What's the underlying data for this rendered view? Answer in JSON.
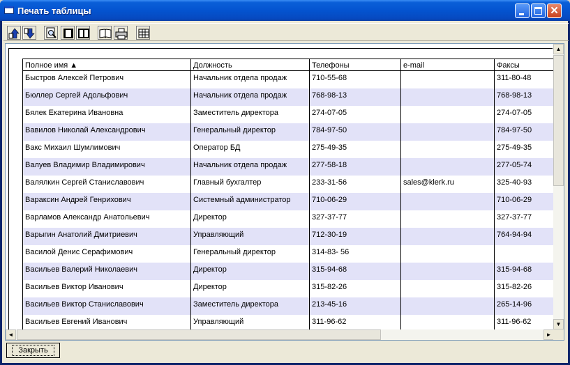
{
  "window": {
    "title": "Печать таблицы",
    "close_glyph": "✕"
  },
  "toolbar": {
    "tools": [
      "up-arrow-icon",
      "down-arrow-icon",
      "zoom-icon",
      "one-page-icon",
      "two-page-icon",
      "book-icon",
      "printer-icon",
      "grid-icon"
    ]
  },
  "table": {
    "headers": [
      "Полное имя ▲",
      "Должность",
      "Телефоны",
      "e-mail",
      "Факсы"
    ],
    "rows": [
      [
        "Быстров Алексей Петрович",
        "Начальник отдела продаж",
        "710-55-68",
        "",
        "311-80-48"
      ],
      [
        "Бюллер Сергей Адольфович",
        "Начальник отдела продаж",
        "768-98-13",
        "",
        "768-98-13"
      ],
      [
        "Бялек Екатерина Ивановна",
        "Заместитель директора",
        "274-07-05",
        "",
        "274-07-05"
      ],
      [
        "Вавилов Николай Александрович",
        "Генеральный директор",
        "784-97-50",
        "",
        "784-97-50"
      ],
      [
        "Вакс Михаил Шумлимович",
        "Оператор БД",
        "275-49-35",
        "",
        "275-49-35"
      ],
      [
        "Валуев Владимир Владимирович",
        "Начальник отдела продаж",
        "277-58-18",
        "",
        "277-05-74"
      ],
      [
        "Валялкин Сергей Станиславович",
        "Главный бухгалтер",
        "233-31-56",
        "sales@klerk.ru",
        "325-40-93"
      ],
      [
        "Вараксин Андрей Генрихович",
        "Системный администратор",
        "710-06-29",
        "",
        "710-06-29"
      ],
      [
        "Варламов Александр Анатольевич",
        "Директор",
        "327-37-77",
        "",
        "327-37-77"
      ],
      [
        "Варыгин Анатолий Дмитриевич",
        "Управляющий",
        "712-30-19",
        "",
        "764-94-94"
      ],
      [
        "Василой Денис Серафимович",
        "Генеральный директор",
        "314-83- 56",
        "",
        ""
      ],
      [
        "Васильев Валерий Николаевич",
        "Директор",
        "315-94-68",
        "",
        "315-94-68"
      ],
      [
        "Васильев Виктор Иванович",
        "Директор",
        "315-82-26",
        "",
        "315-82-26"
      ],
      [
        "Васильев Виктор Станиславович",
        "Заместитель директора",
        "213-45-16",
        "",
        "265-14-96"
      ],
      [
        "Васильев Евгений Иванович",
        "Управляющий",
        "311-96-62",
        "",
        "311-96-62"
      ]
    ]
  },
  "scrollbars": {
    "up": "▲",
    "down": "▼",
    "left": "◄",
    "right": "►"
  },
  "footer": {
    "close_label": "Закрыть"
  }
}
